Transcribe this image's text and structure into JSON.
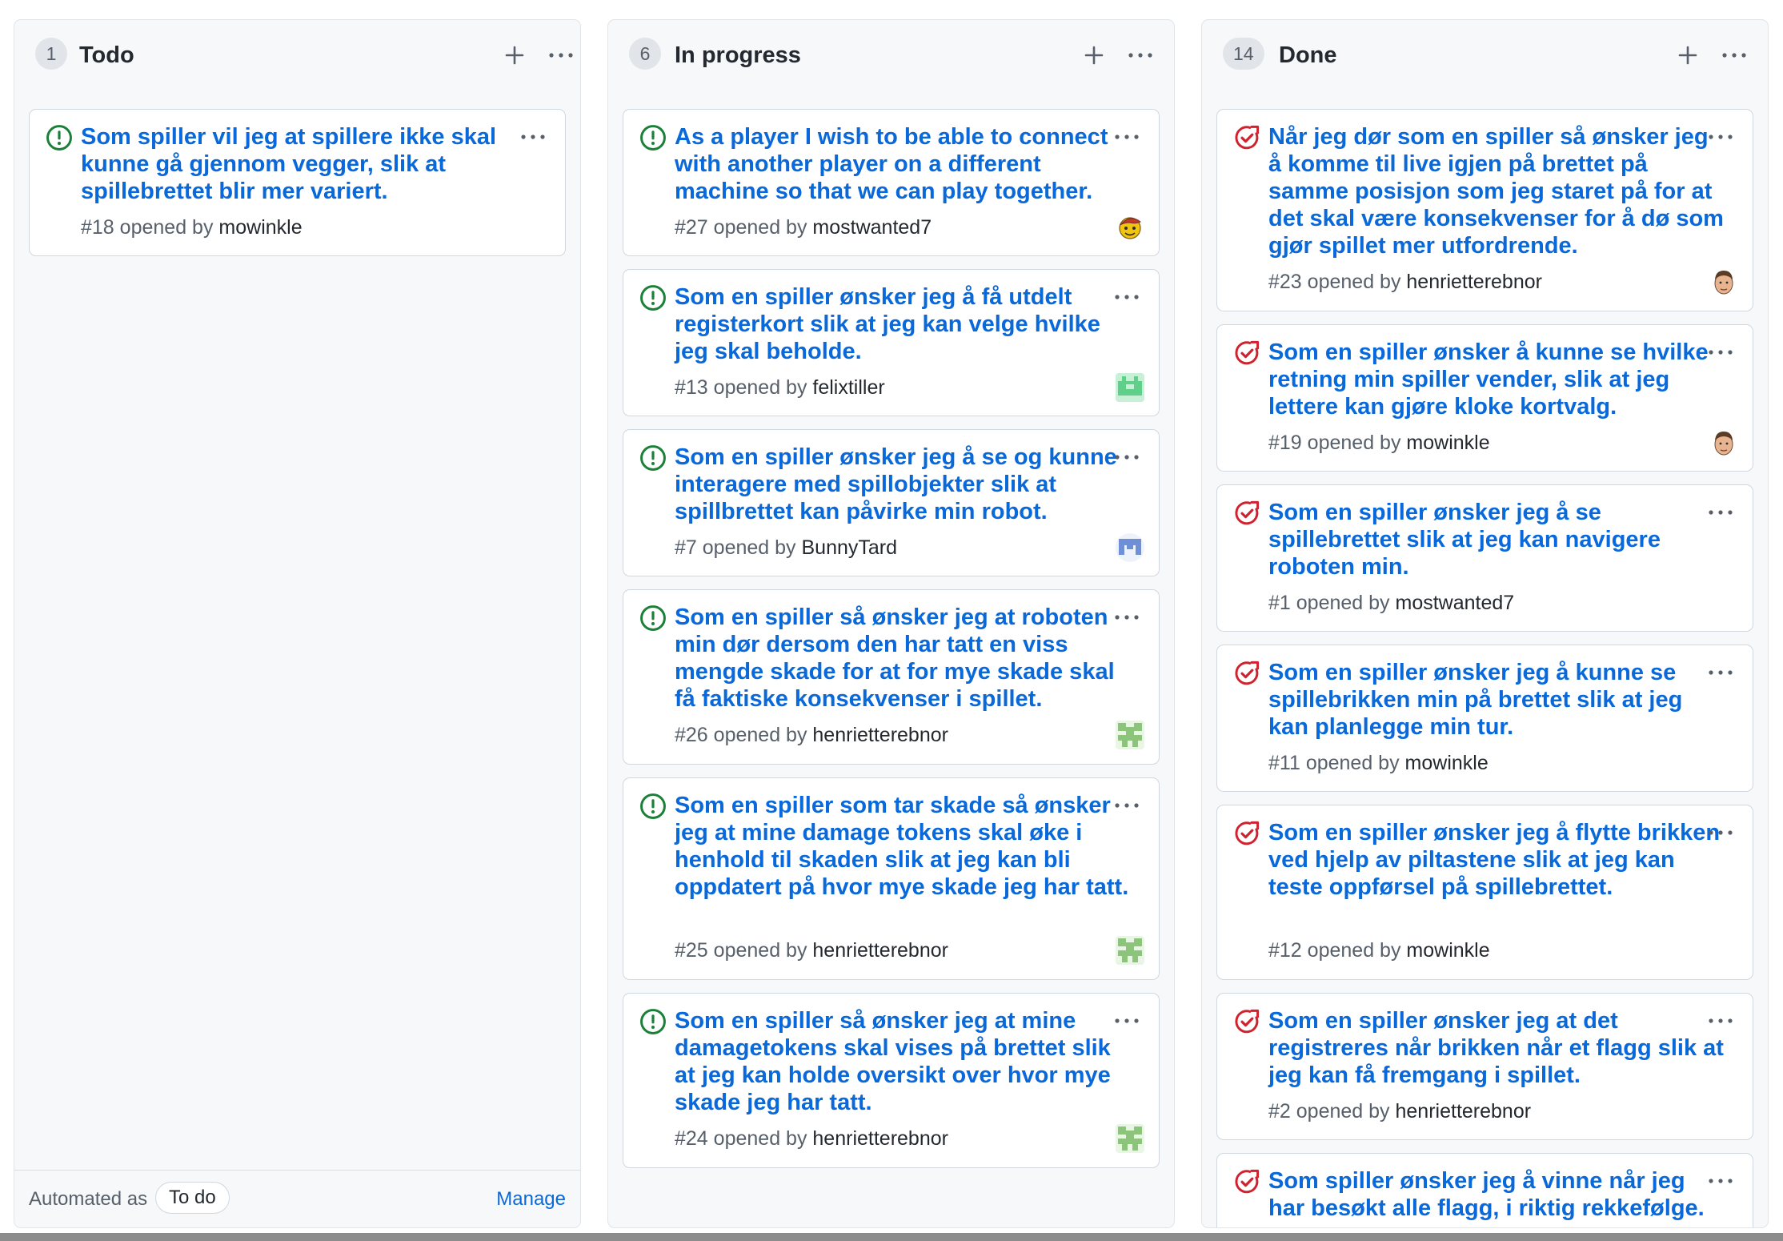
{
  "colors": {
    "accent_link": "#0969da",
    "open_issue_icon": "#1a7f37",
    "closed_issue_icon": "#cf222e",
    "column_bg": "#f6f8fa"
  },
  "columns": [
    {
      "count": "1",
      "title": "Todo",
      "add_icon": "plus-icon",
      "menu_icon": "kebab-horizontal-icon",
      "cards": [
        {
          "state": "open",
          "icon": "issue-opened-icon",
          "title": "Som spiller vil jeg at spillere ikke skal kunne gå gjennom vegger, slik at spillebrettet blir mer variert.",
          "number": "#18",
          "opened_by_text": "opened by",
          "author": "mowinkle"
        }
      ],
      "footer": {
        "automated_as_label": "Automated as",
        "automation_value": "To do",
        "manage_label": "Manage"
      }
    },
    {
      "count": "6",
      "title": "In progress",
      "add_icon": "plus-icon",
      "menu_icon": "kebab-horizontal-icon",
      "cards": [
        {
          "state": "open",
          "icon": "issue-opened-icon",
          "title": "As a player I wish to be able to connect with another player on a different machine so that we can play together.",
          "number": "#27",
          "opened_by_text": "opened by",
          "author": "mostwanted7",
          "avatar": "avatar-mostwanted7"
        },
        {
          "state": "open",
          "icon": "issue-opened-icon",
          "title": "Som en spiller ønsker jeg å få utdelt registerkort slik at jeg kan velge hvilke jeg skal beholde.",
          "number": "#13",
          "opened_by_text": "opened by",
          "author": "felixtiller",
          "avatar": "avatar-felixtiller"
        },
        {
          "state": "open",
          "icon": "issue-opened-icon",
          "title": "Som en spiller ønsker jeg å se og kunne interagere med spillobjekter slik at spillbrettet kan påvirke min robot.",
          "number": "#7",
          "opened_by_text": "opened by",
          "author": "BunnyTard",
          "avatar": "avatar-bunnytard"
        },
        {
          "state": "open",
          "icon": "issue-opened-icon",
          "title": "Som en spiller så ønsker jeg at roboten min dør dersom den har tatt en viss mengde skade for at for mye skade skal få faktiske konsekvenser i spillet.",
          "number": "#26",
          "opened_by_text": "opened by",
          "author": "henrietterebnor",
          "avatar": "avatar-henrietterebnor-identicon"
        },
        {
          "state": "open",
          "icon": "issue-opened-icon",
          "title": "Som en spiller som tar skade så ønsker jeg at mine damage tokens skal øke i henhold til skaden slik at jeg kan bli oppdatert på hvor mye skade jeg har tatt.",
          "number": "#25",
          "opened_by_text": "opened by",
          "author": "henrietterebnor",
          "avatar": "avatar-henrietterebnor-identicon"
        },
        {
          "state": "open",
          "icon": "issue-opened-icon",
          "title": "Som en spiller så ønsker jeg at mine damagetokens skal vises på brettet slik at jeg kan holde oversikt over hvor mye skade jeg har tatt.",
          "number": "#24",
          "opened_by_text": "opened by",
          "author": "henrietterebnor",
          "avatar": "avatar-henrietterebnor-identicon"
        }
      ]
    },
    {
      "count": "14",
      "title": "Done",
      "add_icon": "plus-icon",
      "menu_icon": "kebab-horizontal-icon",
      "cards": [
        {
          "state": "closed",
          "icon": "issue-closed-icon",
          "title": "Når jeg dør som en spiller så ønsker jeg å komme til live igjen på brettet på samme posisjon som jeg staret på for at det skal være konsekvenser for å dø som gjør spillet mer utfordrende.",
          "number": "#23",
          "opened_by_text": "opened by",
          "author": "henrietterebnor",
          "avatar": "avatar-face"
        },
        {
          "state": "closed",
          "icon": "issue-closed-icon",
          "title": "Som en spiller ønsker å kunne se hvilke retning min spiller vender, slik at jeg lettere kan gjøre kloke kortvalg.",
          "number": "#19",
          "opened_by_text": "opened by",
          "author": "mowinkle",
          "avatar": "avatar-face"
        },
        {
          "state": "closed",
          "icon": "issue-closed-icon",
          "title": "Som en spiller ønsker jeg å se spillebrettet slik at jeg kan navigere roboten min.",
          "number": "#1",
          "opened_by_text": "opened by",
          "author": "mostwanted7"
        },
        {
          "state": "closed",
          "icon": "issue-closed-icon",
          "title": "Som en spiller ønsker jeg å kunne se spillebrikken min på brettet slik at jeg kan planlegge min tur.",
          "number": "#11",
          "opened_by_text": "opened by",
          "author": "mowinkle"
        },
        {
          "state": "closed",
          "icon": "issue-closed-icon",
          "title": "Som en spiller ønsker jeg å flytte brikken ved hjelp av piltastene slik at jeg kan teste oppførsel på spillebrettet.",
          "number": "#12",
          "opened_by_text": "opened by",
          "author": "mowinkle"
        },
        {
          "state": "closed",
          "icon": "issue-closed-icon",
          "title": "Som en spiller ønsker jeg at det registreres når brikken når et flagg slik at jeg kan få fremgang i spillet.",
          "number": "#2",
          "opened_by_text": "opened by",
          "author": "henrietterebnor"
        },
        {
          "state": "closed",
          "icon": "issue-closed-icon",
          "title": "Som spiller ønsker jeg å vinne når jeg har besøkt alle flagg, i riktig rekkefølge."
        }
      ]
    }
  ]
}
